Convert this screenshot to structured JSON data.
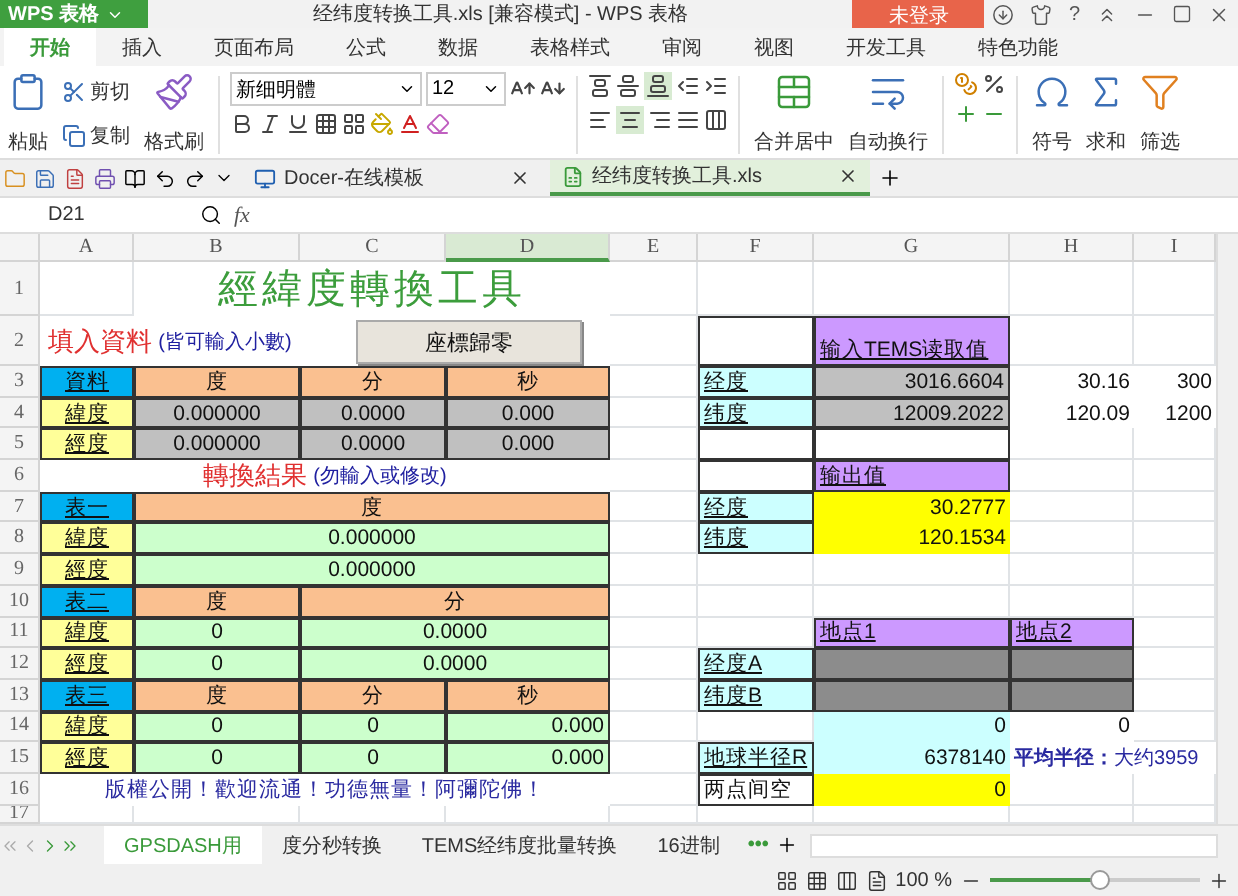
{
  "app_menu": {
    "label": "WPS 表格"
  },
  "window": {
    "title": "经纬度转换工具.xls [兼容模式] - WPS 表格"
  },
  "login_button": {
    "label": "未登录"
  },
  "help": {
    "label": "?"
  },
  "ribbon_tabs": [
    {
      "label": "开始",
      "selected": true
    },
    {
      "label": "插入",
      "selected": false
    },
    {
      "label": "页面布局",
      "selected": false
    },
    {
      "label": "公式",
      "selected": false
    },
    {
      "label": "数据",
      "selected": false
    },
    {
      "label": "表格样式",
      "selected": false
    },
    {
      "label": "审阅",
      "selected": false
    },
    {
      "label": "视图",
      "selected": false
    },
    {
      "label": "开发工具",
      "selected": false
    },
    {
      "label": "特色功能",
      "selected": false
    }
  ],
  "ribbon": {
    "paste": "粘贴",
    "cut": "剪切",
    "copy": "复制",
    "format_painter": "格式刷",
    "font": "新细明體",
    "size": "12",
    "merge": "合并居中",
    "wrap": "自动换行",
    "symbol": "符号",
    "sum": "求和",
    "filter": "筛选"
  },
  "doc_tabs": [
    {
      "label": "Docer-在线模板",
      "selected": false
    },
    {
      "label": "经纬度转换工具.xls",
      "selected": true
    }
  ],
  "formula_bar": {
    "cell": "D21",
    "fx": "fx"
  },
  "columns": [
    {
      "label": "A",
      "selected": false
    },
    {
      "label": "B",
      "selected": false
    },
    {
      "label": "C",
      "selected": false
    },
    {
      "label": "D",
      "selected": true
    },
    {
      "label": "E",
      "selected": false
    },
    {
      "label": "F",
      "selected": false
    },
    {
      "label": "G",
      "selected": false
    },
    {
      "label": "H",
      "selected": false
    },
    {
      "label": "I",
      "selected": false
    }
  ],
  "rows": [
    {
      "number": "1",
      "cells": [
        {
          "kind": "empty"
        },
        {
          "kind": "title",
          "text": "經緯度轉換工具"
        },
        {
          "kind": "merged"
        },
        {
          "kind": "merged"
        }
      ]
    },
    {
      "number": "2",
      "cells": [
        {
          "kind": "heading",
          "text": "填入資料",
          "note": "(皆可輸入小數)"
        },
        {
          "kind": "merged"
        },
        {
          "kind": "button",
          "text": "座標歸零"
        },
        {
          "kind": "merged"
        },
        {
          "kind": "empty"
        },
        {
          "kind": "frame"
        },
        {
          "kind": "violet",
          "text": "输入TEMS读取值"
        }
      ]
    },
    {
      "number": "3",
      "cells": [
        {
          "kind": "blue",
          "text": "資料"
        },
        {
          "kind": "head",
          "text": "度"
        },
        {
          "kind": "head",
          "text": "分"
        },
        {
          "kind": "head",
          "text": "秒"
        },
        {
          "kind": "empty"
        },
        {
          "kind": "tag",
          "text": "经度"
        },
        {
          "kind": "reading",
          "text": "3016.6604"
        },
        {
          "kind": "plain",
          "text": "30.16"
        },
        {
          "kind": "plain",
          "text": "300"
        }
      ]
    },
    {
      "number": "4",
      "cells": [
        {
          "kind": "label",
          "text": "緯度"
        },
        {
          "kind": "input",
          "text": "0.000000"
        },
        {
          "kind": "input",
          "text": "0.0000"
        },
        {
          "kind": "input",
          "text": "0.000"
        },
        {
          "kind": "empty"
        },
        {
          "kind": "tag",
          "text": "纬度"
        },
        {
          "kind": "reading",
          "text": "12009.2022"
        },
        {
          "kind": "plain",
          "text": "120.09"
        },
        {
          "kind": "plain",
          "text": "1200"
        }
      ]
    },
    {
      "number": "5",
      "cells": [
        {
          "kind": "label",
          "text": "經度"
        },
        {
          "kind": "input",
          "text": "0.000000"
        },
        {
          "kind": "input",
          "text": "0.0000"
        },
        {
          "kind": "input",
          "text": "0.000"
        },
        {
          "kind": "empty"
        },
        {
          "kind": "frame"
        },
        {
          "kind": "frame"
        }
      ]
    },
    {
      "number": "6",
      "cells": [
        {
          "kind": "heading",
          "text": "轉換結果",
          "note": "(勿輸入或修改)"
        },
        {
          "kind": "merged"
        },
        {
          "kind": "merged"
        },
        {
          "kind": "merged"
        },
        {
          "kind": "empty"
        },
        {
          "kind": "frame"
        },
        {
          "kind": "violet",
          "text": "输出值"
        }
      ]
    },
    {
      "number": "7",
      "cells": [
        {
          "kind": "blue",
          "text": "表一"
        },
        {
          "kind": "head",
          "text": "度"
        },
        {
          "kind": "merged"
        },
        {
          "kind": "merged"
        },
        {
          "kind": "empty"
        },
        {
          "kind": "tag",
          "text": "经度"
        },
        {
          "kind": "bright",
          "text": "30.2777"
        }
      ]
    },
    {
      "number": "8",
      "cells": [
        {
          "kind": "label",
          "text": "緯度"
        },
        {
          "kind": "result",
          "text": "0.000000"
        },
        {
          "kind": "merged"
        },
        {
          "kind": "merged"
        },
        {
          "kind": "empty"
        },
        {
          "kind": "tag",
          "text": "纬度"
        },
        {
          "kind": "bright",
          "text": "120.1534"
        }
      ]
    },
    {
      "number": "9",
      "cells": [
        {
          "kind": "label",
          "text": "經度"
        },
        {
          "kind": "result",
          "text": "0.000000"
        },
        {
          "kind": "merged"
        },
        {
          "kind": "merged"
        }
      ]
    },
    {
      "number": "10",
      "cells": [
        {
          "kind": "blue",
          "text": "表二"
        },
        {
          "kind": "head",
          "text": "度"
        },
        {
          "kind": "head",
          "text": "分"
        },
        {
          "kind": "merged"
        }
      ]
    },
    {
      "number": "11",
      "cells": [
        {
          "kind": "label",
          "text": "緯度"
        },
        {
          "kind": "result",
          "text": "0"
        },
        {
          "kind": "result",
          "text": "0.0000"
        },
        {
          "kind": "merged"
        },
        {
          "kind": "empty"
        },
        {
          "kind": "empty"
        },
        {
          "kind": "violet",
          "text": "地点1"
        },
        {
          "kind": "violet",
          "text": "地点2"
        }
      ]
    },
    {
      "number": "12",
      "cells": [
        {
          "kind": "label",
          "text": "經度"
        },
        {
          "kind": "result",
          "text": "0"
        },
        {
          "kind": "result",
          "text": "0.0000"
        },
        {
          "kind": "merged"
        },
        {
          "kind": "empty"
        },
        {
          "kind": "tag",
          "text": "经度A"
        },
        {
          "kind": "dark"
        },
        {
          "kind": "dark"
        }
      ]
    },
    {
      "number": "13",
      "cells": [
        {
          "kind": "blue",
          "text": "表三"
        },
        {
          "kind": "head",
          "text": "度"
        },
        {
          "kind": "head",
          "text": "分"
        },
        {
          "kind": "head",
          "text": "秒"
        },
        {
          "kind": "empty"
        },
        {
          "kind": "tag",
          "text": "纬度B"
        },
        {
          "kind": "dark"
        },
        {
          "kind": "dark"
        }
      ]
    },
    {
      "number": "14",
      "cells": [
        {
          "kind": "label",
          "text": "緯度"
        },
        {
          "kind": "result",
          "text": "0"
        },
        {
          "kind": "result",
          "text": "0"
        },
        {
          "kind": "figure",
          "text": "0.000"
        },
        {
          "kind": "empty"
        },
        {
          "kind": "empty"
        },
        {
          "kind": "pale",
          "text": "0"
        },
        {
          "kind": "plain",
          "text": "0"
        }
      ]
    },
    {
      "number": "15",
      "cells": [
        {
          "kind": "label",
          "text": "經度"
        },
        {
          "kind": "result",
          "text": "0"
        },
        {
          "kind": "result",
          "text": "0"
        },
        {
          "kind": "figure",
          "text": "0.000"
        },
        {
          "kind": "empty"
        },
        {
          "kind": "tag",
          "text": "地球半径R"
        },
        {
          "kind": "pale",
          "text": "6378140"
        },
        {
          "kind": "remark",
          "text": "**平均半径：**大约3959"
        },
        {
          "kind": "merged"
        }
      ]
    },
    {
      "number": "16",
      "cells": [
        {
          "kind": "footer",
          "text": "版權公開！歡迎流通！功德無量！阿彌陀佛！"
        },
        {
          "kind": "merged"
        },
        {
          "kind": "merged"
        },
        {
          "kind": "merged"
        },
        {
          "kind": "empty"
        },
        {
          "kind": "frame",
          "text": "两点间空"
        },
        {
          "kind": "bright",
          "text": "0"
        }
      ]
    },
    {
      "number": "17"
    }
  ],
  "sheet_tabs": [
    {
      "label": "GPSDASH用",
      "selected": true
    },
    {
      "label": "度分秒转换",
      "selected": false
    },
    {
      "label": "TEMS经纬度批量转换",
      "selected": false
    },
    {
      "label": "16进制",
      "selected": false
    }
  ],
  "more_sheets": "•••",
  "status_bar": {
    "zoom": "100 %",
    "zoom_slider": {
      "level": 0.52
    }
  }
}
